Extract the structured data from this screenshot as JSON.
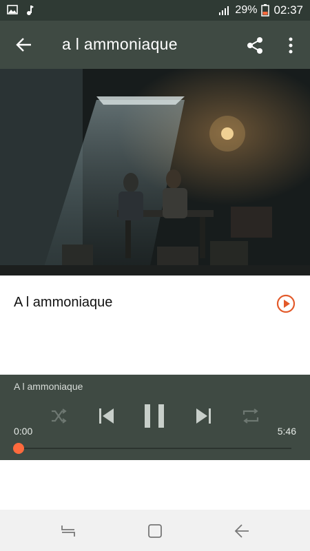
{
  "status": {
    "battery_percent": "29%",
    "time": "02:37",
    "icons": [
      "image-icon",
      "music-note-icon",
      "signal-icon",
      "battery-icon"
    ]
  },
  "appbar": {
    "title": "a l ammoniaque",
    "icons": [
      "back-arrow-icon",
      "share-icon",
      "more-vert-icon"
    ]
  },
  "track": {
    "title": "A l ammoniaque"
  },
  "player": {
    "now_playing": "A l ammoniaque",
    "current_time": "0:00",
    "total_time": "5:46",
    "progress_fraction": 0.0,
    "state": "playing"
  },
  "colors": {
    "toolbar": "#3f4a43",
    "statusbar": "#2f3a34",
    "accent": "#ff6a3d",
    "play_outline": "#e35a2a"
  }
}
